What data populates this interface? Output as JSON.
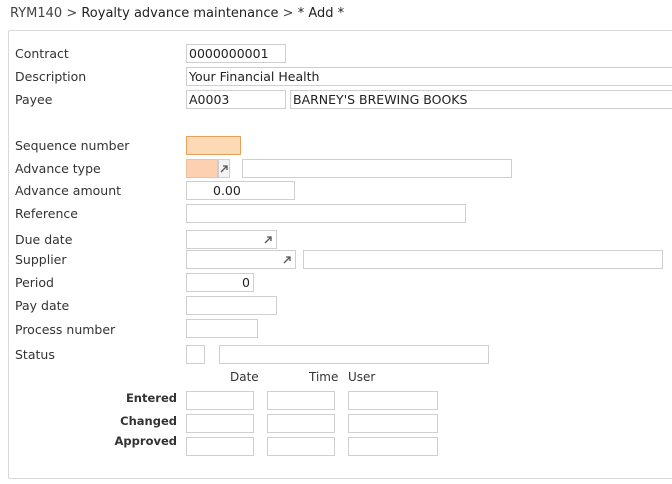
{
  "breadcrumb": {
    "program": "RYM140",
    "separator1": ">",
    "title": "Royalty advance maintenance",
    "separator2": ">",
    "mode": "* Add *"
  },
  "form": {
    "contract": {
      "label": "Contract",
      "value": "0000000001"
    },
    "description": {
      "label": "Description",
      "value": "Your Financial Health"
    },
    "payee": {
      "label": "Payee",
      "code": "A0003",
      "name": "BARNEY'S BREWING BOOKS"
    },
    "sequence_number": {
      "label": "Sequence number",
      "value": ""
    },
    "advance_type": {
      "label": "Advance type",
      "value": "",
      "description": ""
    },
    "advance_amount": {
      "label": "Advance amount",
      "value": "0.00"
    },
    "reference": {
      "label": "Reference",
      "value": ""
    },
    "due_date": {
      "label": "Due date",
      "value": ""
    },
    "supplier": {
      "label": "Supplier",
      "value": "",
      "name": ""
    },
    "period": {
      "label": "Period",
      "value": "0"
    },
    "pay_date": {
      "label": "Pay date",
      "value": ""
    },
    "process_number": {
      "label": "Process number",
      "value": ""
    },
    "status": {
      "label": "Status",
      "code": "",
      "description": ""
    }
  },
  "audit": {
    "headers": {
      "date": "Date",
      "time": "Time",
      "user": "User"
    },
    "rows": [
      {
        "label": "Entered",
        "date": "",
        "time": "",
        "user": ""
      },
      {
        "label": "Changed",
        "date": "",
        "time": "",
        "user": ""
      },
      {
        "label": "Approved",
        "date": "",
        "time": "",
        "user": ""
      }
    ]
  },
  "icons": {
    "prompt": "prompt-arrow-icon"
  },
  "colors": {
    "focus_fill": "#fdd9b5",
    "focus_border": "#e6a15c",
    "error_fill": "#fcd0b0",
    "prompt_icon": "#555555"
  }
}
